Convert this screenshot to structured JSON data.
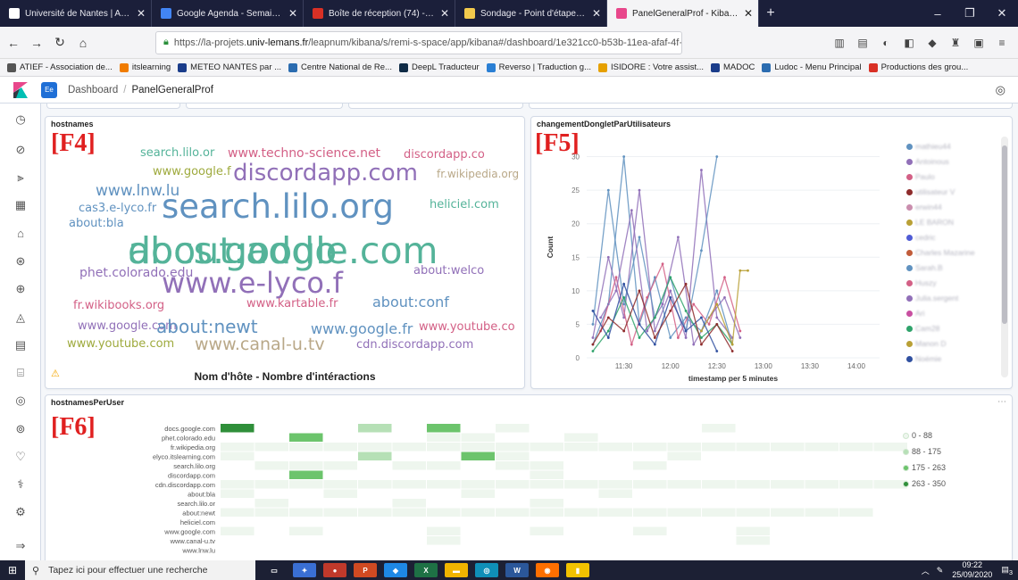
{
  "browser": {
    "tabs": [
      {
        "title": "Université de Nantes | Accueil",
        "color": "#ffffff"
      },
      {
        "title": "Google Agenda - Semaine du 2",
        "color": "#4285f4"
      },
      {
        "title": "Boîte de réception (74) - joelpe",
        "color": "#d93025"
      },
      {
        "title": "Sondage - Point d'étape Leap",
        "color": "#f2c94c"
      },
      {
        "title": "PanelGeneralProf - Kibana",
        "color": "#e8478b",
        "active": true
      }
    ],
    "new_tab": "+",
    "window_controls": [
      "–",
      "❐",
      "✕"
    ],
    "url": {
      "prefix": "https://la-projets.",
      "host": "univ-lemans.fr",
      "path": "/leapnum/kibana/s/remi-s-space/app/kibana#/dashboard/1e321cc0-b53b-11ea-afaf-4f",
      "suffix": "··· ♥ ☆"
    }
  },
  "bookmarks": [
    {
      "label": "ATIEF - Association de...",
      "color": "#555555"
    },
    {
      "label": "itslearning",
      "color": "#f07c00"
    },
    {
      "label": "METEO NANTES par ...",
      "color": "#1a3c8a"
    },
    {
      "label": "Centre National de Re...",
      "color": "#2b6cb0"
    },
    {
      "label": "DeepL Traducteur",
      "color": "#0f2b46"
    },
    {
      "label": "Reverso | Traduction g...",
      "color": "#2a7fd4"
    },
    {
      "label": "ISIDORE : Votre assist...",
      "color": "#e6a000"
    },
    {
      "label": "MADOC",
      "color": "#1a3c8a"
    },
    {
      "label": "Ludoc - Menu Principal",
      "color": "#2b6cb0"
    },
    {
      "label": "Productions des grou...",
      "color": "#d93025"
    }
  ],
  "kibana": {
    "space": "Ee",
    "breadcrumb": [
      "Dashboard",
      "PanelGeneralProf"
    ],
    "nav_icons": [
      "clock-icon",
      "compass-icon",
      "visualize-icon",
      "dashboard-icon",
      "canvas-icon",
      "maps-icon",
      "ml-icon",
      "infra-icon",
      "logs-icon",
      "apm-icon",
      "uptime-icon",
      "siem-icon",
      "devtools-icon",
      "monitoring-icon",
      "management-icon"
    ]
  },
  "panels": {
    "hostnames": {
      "title": "hostnames",
      "marker": "[F4]",
      "footer": "Nom d'hôte - Nombre d'intéractions",
      "warning": "⚠",
      "words": [
        {
          "text": "search.lilo.or",
          "color": "#54b399"
        },
        {
          "text": "www.techno-science.net",
          "color": "#d36086"
        },
        {
          "text": "discordapp.co",
          "color": "#d36086"
        },
        {
          "text": "www.google.f",
          "color": "#9eaa3d"
        },
        {
          "text": "discordapp.com",
          "color": "#9170b8"
        },
        {
          "text": "fr.wikipedia.org",
          "color": "#b9a888"
        },
        {
          "text": "www.lnw.lu",
          "color": "#6092c0"
        },
        {
          "text": "cas3.e-lyco.fr",
          "color": "#6092c0"
        },
        {
          "text": "search.lilo.org",
          "color": "#6092c0"
        },
        {
          "text": "heliciel.com",
          "color": "#54b399"
        },
        {
          "text": "about:bla",
          "color": "#6092c0"
        },
        {
          "text": "docs.google.com",
          "color": "#54b399"
        },
        {
          "text": "about:addo",
          "color": "#54b399"
        },
        {
          "text": "phet.colorado.edu",
          "color": "#9170b8"
        },
        {
          "text": "about:welco",
          "color": "#9170b8"
        },
        {
          "text": "www.e-lyco.f",
          "color": "#9170b8"
        },
        {
          "text": "fr.wikibooks.org",
          "color": "#d36086"
        },
        {
          "text": "www.kartable.fr",
          "color": "#d36086"
        },
        {
          "text": "about:conf",
          "color": "#6092c0"
        },
        {
          "text": "www.google.com",
          "color": "#9170b8"
        },
        {
          "text": "about:newt",
          "color": "#6092c0"
        },
        {
          "text": "www.google.fr",
          "color": "#6092c0"
        },
        {
          "text": "www.youtube.co",
          "color": "#d36086"
        },
        {
          "text": "www.youtube.com",
          "color": "#9eaa3d"
        },
        {
          "text": "www.canal-u.tv",
          "color": "#b9a888"
        },
        {
          "text": "cdn.discordapp.com",
          "color": "#9170b8"
        }
      ]
    },
    "changement": {
      "title": "changementDongletParUtilisateurs",
      "marker": "[F5]",
      "legend": [
        {
          "label": "mathieu44",
          "color": "#6092c0"
        },
        {
          "label": "Antoinous",
          "color": "#9170b8"
        },
        {
          "label": "Paulo",
          "color": "#d36086"
        },
        {
          "label": "utilisateur V",
          "color": "#8e2b2b"
        },
        {
          "label": "erwin44",
          "color": "#ca8eae"
        },
        {
          "label": "LE BARON",
          "color": "#b9a036"
        },
        {
          "label": "cedric",
          "color": "#4f5bd5"
        },
        {
          "label": "Charles Mazarine",
          "color": "#c15c3a"
        },
        {
          "label": "Sarah.B",
          "color": "#6092c0"
        },
        {
          "label": "Huszy",
          "color": "#d36086"
        },
        {
          "label": "Julia.sergent",
          "color": "#9170b8"
        },
        {
          "label": "Ari",
          "color": "#c84fa0"
        },
        {
          "label": "Cam28",
          "color": "#2fa36b"
        },
        {
          "label": "Manon D",
          "color": "#b9a036"
        },
        {
          "label": "Noémie",
          "color": "#3050a0"
        }
      ]
    },
    "hostnamesPerUser": {
      "title": "hostnamesPerUser",
      "marker": "[F6]",
      "rows": [
        "docs.google.com",
        "phet.colorado.edu",
        "fr.wikipedia.org",
        "elyco.itslearning.com",
        "search.lilo.org",
        "discordapp.com",
        "cdn.discordapp.com",
        "about:bla",
        "search.lilo.or",
        "about:newt",
        "heliciel.com",
        "www.google.com",
        "www.canal-u.tv",
        "www.lnw.lu"
      ],
      "legend": [
        {
          "label": "0 - 88",
          "color": "#eef6ee"
        },
        {
          "label": "88 - 175",
          "color": "#b6e0b6"
        },
        {
          "label": "175 - 263",
          "color": "#6cc46c"
        },
        {
          "label": "263 - 350",
          "color": "#2f8f3a"
        }
      ]
    }
  },
  "chart_data": [
    {
      "type": "line",
      "title": "changementDongletParUtilisateurs",
      "xlabel": "timestamp per 5 minutes",
      "ylabel": "Count",
      "x_ticks": [
        "11:30",
        "12:00",
        "12:30",
        "13:00",
        "13:30",
        "14:00"
      ],
      "y_ticks": [
        0,
        5,
        10,
        15,
        20,
        25,
        30
      ],
      "ylim": [
        0,
        33
      ],
      "x_range": [
        "11:06",
        "14:15"
      ],
      "series": [
        {
          "name": "mathieu44",
          "x": [
            "11:10",
            "11:20",
            "11:30",
            "11:40",
            "11:50",
            "12:00",
            "12:10",
            "12:20",
            "12:30",
            "12:40"
          ],
          "values": [
            2,
            8,
            30,
            5,
            12,
            3,
            6,
            4,
            10,
            2
          ]
        },
        {
          "name": "Antoinous",
          "x": [
            "11:10",
            "11:20",
            "11:30",
            "11:40",
            "11:50",
            "12:00",
            "12:10",
            "12:20",
            "12:30",
            "12:40"
          ],
          "values": [
            3,
            15,
            6,
            25,
            4,
            10,
            3,
            28,
            6,
            3
          ]
        },
        {
          "name": "Paulo",
          "x": [
            "11:15",
            "11:25",
            "11:35",
            "11:45",
            "11:55",
            "12:05",
            "12:15",
            "12:25",
            "12:35",
            "12:45"
          ],
          "values": [
            4,
            12,
            2,
            9,
            14,
            3,
            8,
            5,
            12,
            4
          ]
        },
        {
          "name": "Sarah.B",
          "x": [
            "11:10",
            "11:20",
            "11:30",
            "11:40",
            "11:50",
            "12:00",
            "12:10",
            "12:20",
            "12:30"
          ],
          "values": [
            5,
            25,
            8,
            18,
            6,
            12,
            4,
            16,
            30
          ]
        },
        {
          "name": "Julia.sergent",
          "x": [
            "11:15",
            "11:25",
            "11:35",
            "11:45",
            "11:55",
            "12:05",
            "12:15",
            "12:25",
            "12:35",
            "12:45"
          ],
          "values": [
            6,
            10,
            22,
            4,
            8,
            18,
            2,
            6,
            9,
            3
          ]
        },
        {
          "name": "Cam28",
          "x": [
            "11:10",
            "11:20",
            "11:30",
            "11:40",
            "11:50",
            "12:00",
            "12:10",
            "12:20",
            "12:30",
            "12:40"
          ],
          "values": [
            1,
            4,
            9,
            3,
            6,
            12,
            7,
            3,
            5,
            2
          ]
        },
        {
          "name": "Manon D",
          "x": [
            "12:20",
            "12:30",
            "12:40",
            "12:45",
            "12:50"
          ],
          "values": [
            4,
            8,
            2,
            13,
            13
          ]
        },
        {
          "name": "Noémie",
          "x": [
            "11:10",
            "11:20",
            "11:30",
            "11:40",
            "11:50",
            "12:00",
            "12:10",
            "12:20",
            "12:30"
          ],
          "values": [
            7,
            3,
            11,
            5,
            2,
            9,
            4,
            6,
            1
          ]
        },
        {
          "name": "utilisateur V",
          "x": [
            "11:10",
            "11:20",
            "11:30",
            "11:40",
            "11:50",
            "12:00",
            "12:10",
            "12:20",
            "12:30",
            "12:40"
          ],
          "values": [
            2,
            6,
            4,
            10,
            3,
            7,
            11,
            2,
            5,
            1
          ]
        }
      ]
    },
    {
      "type": "heatmap",
      "title": "hostnamesPerUser",
      "rows": [
        "docs.google.com",
        "phet.colorado.edu",
        "fr.wikipedia.org",
        "elyco.itslearning.com",
        "search.lilo.org",
        "discordapp.com",
        "cdn.discordapp.com",
        "about:bla",
        "search.lilo.or",
        "about:newt",
        "heliciel.com",
        "www.google.com",
        "www.canal-u.tv",
        "www.lnw.lu"
      ],
      "columns": 20,
      "values": [
        [
          300,
          0,
          0,
          0,
          110,
          0,
          220,
          0,
          40,
          0,
          0,
          0,
          0,
          0,
          20,
          0,
          0,
          0,
          0,
          0
        ],
        [
          0,
          0,
          230,
          0,
          0,
          0,
          30,
          30,
          0,
          0,
          20,
          0,
          0,
          0,
          0,
          0,
          0,
          0,
          0,
          0
        ],
        [
          20,
          20,
          20,
          20,
          20,
          20,
          20,
          20,
          20,
          20,
          20,
          20,
          20,
          20,
          20,
          20,
          20,
          20,
          20,
          20
        ],
        [
          40,
          0,
          0,
          0,
          110,
          0,
          0,
          200,
          60,
          0,
          0,
          0,
          0,
          30,
          0,
          0,
          0,
          0,
          0,
          0
        ],
        [
          0,
          60,
          10,
          80,
          0,
          80,
          30,
          0,
          60,
          20,
          0,
          0,
          20,
          0,
          0,
          0,
          0,
          0,
          0,
          0
        ],
        [
          0,
          0,
          240,
          0,
          0,
          0,
          0,
          0,
          0,
          20,
          0,
          0,
          0,
          0,
          0,
          0,
          0,
          0,
          0,
          0
        ],
        [
          20,
          20,
          20,
          20,
          20,
          20,
          20,
          20,
          20,
          20,
          20,
          20,
          20,
          20,
          20,
          20,
          20,
          20,
          20,
          20
        ],
        [
          10,
          0,
          0,
          10,
          0,
          0,
          0,
          20,
          0,
          0,
          0,
          10,
          0,
          0,
          0,
          0,
          0,
          0,
          0,
          0
        ],
        [
          0,
          10,
          0,
          0,
          0,
          10,
          0,
          0,
          0,
          10,
          0,
          0,
          0,
          0,
          0,
          0,
          0,
          0,
          0,
          0
        ],
        [
          10,
          10,
          10,
          10,
          10,
          10,
          10,
          10,
          10,
          10,
          10,
          10,
          10,
          10,
          10,
          10,
          10,
          10,
          20,
          0
        ],
        [
          0,
          0,
          0,
          0,
          0,
          0,
          0,
          0,
          0,
          0,
          0,
          0,
          0,
          0,
          0,
          0,
          0,
          0,
          0,
          0
        ],
        [
          10,
          0,
          10,
          0,
          0,
          0,
          10,
          0,
          0,
          10,
          0,
          0,
          10,
          0,
          0,
          10,
          0,
          0,
          0,
          0
        ],
        [
          0,
          0,
          0,
          0,
          0,
          0,
          10,
          0,
          0,
          0,
          0,
          0,
          0,
          0,
          0,
          10,
          0,
          0,
          0,
          0
        ],
        [
          0,
          0,
          0,
          0,
          0,
          0,
          0,
          0,
          0,
          0,
          0,
          0,
          0,
          0,
          0,
          0,
          0,
          0,
          0,
          0
        ]
      ],
      "legend": [
        "0 - 88",
        "88 - 175",
        "175 - 263",
        "263 - 350"
      ]
    }
  ],
  "taskbar": {
    "search_placeholder": "Tapez ici pour effectuer une recherche",
    "time": "09:22",
    "date": "25/09/2020",
    "notif_count": "3",
    "apps": [
      {
        "label": "▭",
        "color": "#1c2034"
      },
      {
        "label": "✦",
        "color": "#3a6fd4"
      },
      {
        "label": "●",
        "color": "#c0392b"
      },
      {
        "label": "P",
        "color": "#d04a22"
      },
      {
        "label": "◆",
        "color": "#1e88e5"
      },
      {
        "label": "X",
        "color": "#1e7145"
      },
      {
        "label": "▬",
        "color": "#f0b400"
      },
      {
        "label": "◎",
        "color": "#0f8fb8"
      },
      {
        "label": "W",
        "color": "#2b579a"
      },
      {
        "label": "◉",
        "color": "#ff6f00"
      },
      {
        "label": "▮",
        "color": "#f2c200"
      }
    ]
  }
}
